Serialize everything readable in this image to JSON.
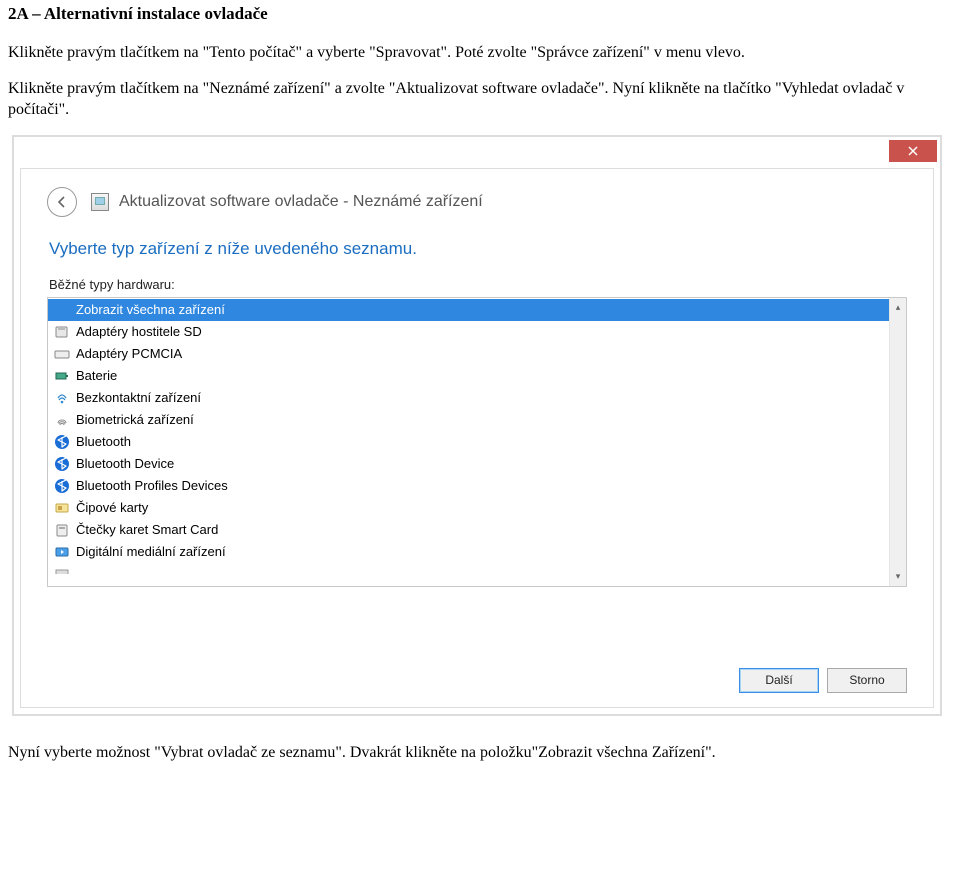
{
  "doc": {
    "heading": "2A – Alternativní instalace ovladače",
    "para1": "Klikněte pravým tlačítkem na \"Tento počítač\" a vyberte \"Spravovat\". Poté zvolte \"Správce zařízení\" v menu vlevo.",
    "para2": "Klikněte pravým tlačítkem na \"Neznámé zařízení\" a zvolte \"Aktualizovat software ovladače\". Nyní klikněte na tlačítko \"Vyhledat ovladač v počítači\".",
    "footer": "Nyní vyberte možnost \"Vybrat ovladač ze seznamu\". Dvakrát klikněte na položku\"Zobrazit všechna Zařízení\"."
  },
  "dialog": {
    "title": "Aktualizovat software ovladače - Neznámé zařízení",
    "instruction": "Vyberte typ zařízení z níže uvedeného seznamu.",
    "list_label": "Běžné typy hardwaru:",
    "items": [
      {
        "label": "Zobrazit všechna zařízení",
        "icon": "none",
        "selected": true
      },
      {
        "label": "Adaptéry hostitele SD",
        "icon": "card"
      },
      {
        "label": "Adaptéry PCMCIA",
        "icon": "pcmcia"
      },
      {
        "label": "Baterie",
        "icon": "battery"
      },
      {
        "label": "Bezkontaktní zařízení",
        "icon": "nfc"
      },
      {
        "label": "Biometrická zařízení",
        "icon": "fingerprint"
      },
      {
        "label": "Bluetooth",
        "icon": "bluetooth"
      },
      {
        "label": "Bluetooth Device",
        "icon": "bluetooth"
      },
      {
        "label": "Bluetooth Profiles Devices",
        "icon": "bluetooth"
      },
      {
        "label": "Čipové karty",
        "icon": "chip"
      },
      {
        "label": "Čtečky karet Smart Card",
        "icon": "reader"
      },
      {
        "label": "Digitální mediální zařízení",
        "icon": "media"
      }
    ],
    "next_btn": "Další",
    "cancel_btn": "Storno"
  }
}
